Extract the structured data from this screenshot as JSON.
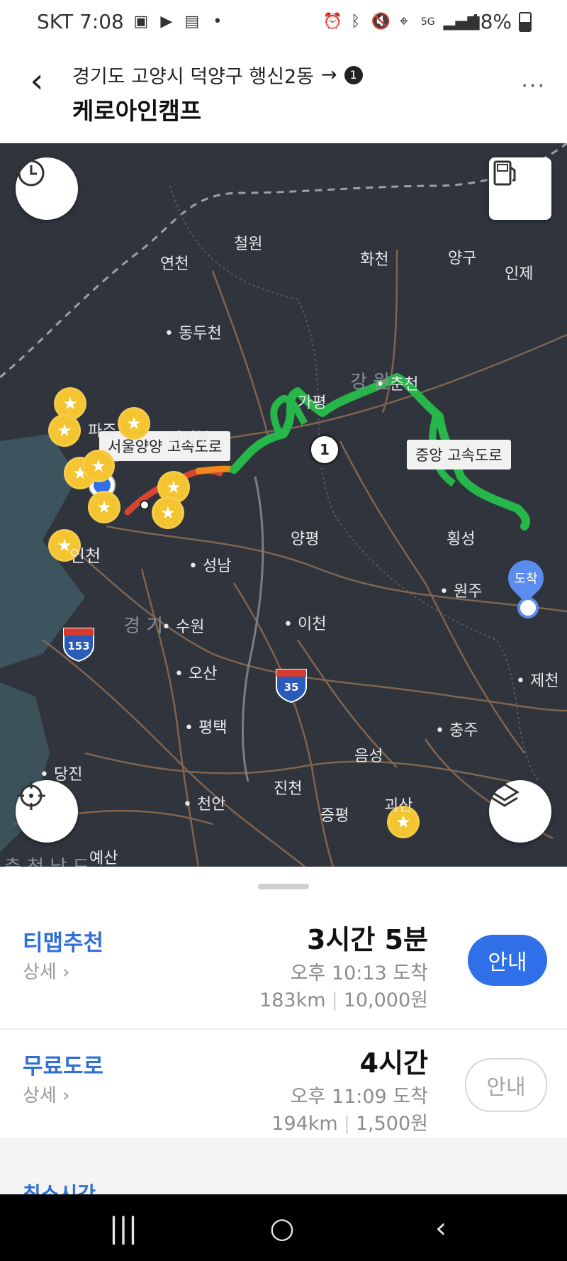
{
  "status_bar": {
    "carrier_time": "SKT 7:08",
    "battery": "48%",
    "left_icons": [
      "gallery-icon",
      "youtube-icon",
      "wallet-icon",
      "dot-icon"
    ],
    "right_icons": [
      "alarm-icon",
      "bluetooth-icon",
      "mute-icon",
      "location-icon",
      "5g-icon",
      "signal-icon",
      "battery-icon"
    ]
  },
  "header": {
    "origin": "경기도 고양시 덕양구 행신2동",
    "arrow": "→",
    "stop_number": "1",
    "destination": "케로아인캠프",
    "more": "···"
  },
  "map": {
    "road_labels": {
      "road1": "서울양양 고속도로",
      "road2": "중앙 고속도로"
    },
    "route_marker": "1",
    "arrival_pin": "도착",
    "highways": [
      "153",
      "35"
    ],
    "places": {
      "cheorwon": "철원",
      "yeoncheon": "연천",
      "hwacheon": "화천",
      "yanggu": "양구",
      "inje": "인제",
      "dongducheon": "동두천",
      "gapyeong": "가평",
      "chuncheon": "춘천",
      "gangwon": "강 원",
      "paju": "파주",
      "uijeongbu": "의정부",
      "yangpyeong": "양평",
      "hoengseong": "횡성",
      "incheon": "인천",
      "seongnam": "성남",
      "wonju": "원주",
      "gyeonggi": "경 기",
      "suwon": "수원",
      "icheon": "이천",
      "osan": "오산",
      "jecheon": "제천",
      "pyeongtaek": "평택",
      "chungju": "충주",
      "eumseong": "음성",
      "dangjin": "당진",
      "jincheon": "진천",
      "goesan": "괴산",
      "cheonan": "천안",
      "jeungpyeong": "증평",
      "yesan": "예산",
      "chungnam": "충 청 남 도"
    }
  },
  "routes": [
    {
      "name": "티맵추천",
      "detail": "상세",
      "time": "3시간 5분",
      "arrive": "오후 10:13 도착",
      "distance": "183km",
      "fee": "10,000원",
      "button": "안내"
    },
    {
      "name": "무료도로",
      "detail": "상세",
      "time": "4시간",
      "arrive": "오후 11:09 도착",
      "distance": "194km",
      "fee": "1,500원",
      "button": "안내"
    }
  ],
  "cut_off_text": "최소시간",
  "navbar": {
    "recent": "|||",
    "home": "○",
    "back": "‹"
  }
}
